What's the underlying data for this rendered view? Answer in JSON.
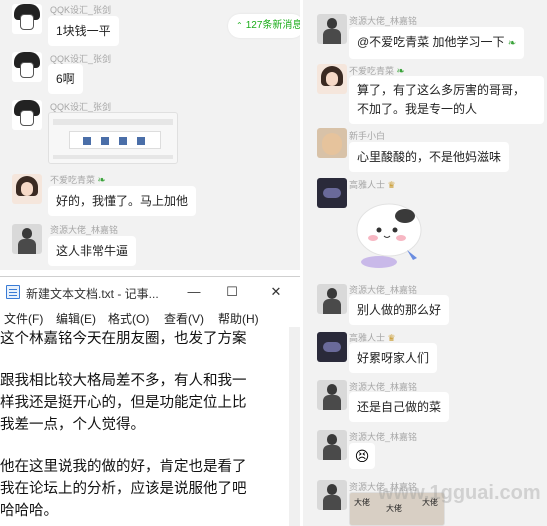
{
  "left_chat": {
    "new_messages_pill": "127条新消息",
    "messages": [
      {
        "sender": "QQK设汇_张剑",
        "text": "1块钱一平"
      },
      {
        "sender": "QQK设汇_张剑",
        "text": "6啊"
      },
      {
        "sender": "QQK设汇_张剑",
        "text": ""
      },
      {
        "sender": "不爱吃青菜",
        "text": "好的，我懂了。马上加他"
      },
      {
        "sender": "资源大佬_林嘉铭",
        "text": "这人非常牛逼"
      }
    ]
  },
  "notepad": {
    "title": "新建文本文档.txt - 记事...",
    "menus": [
      "文件(F)",
      "编辑(E)",
      "格式(O)",
      "查看(V)",
      "帮助(H)"
    ],
    "lines": [
      "这个林嘉铭今天在朋友圈，也发了方案",
      "",
      "跟我相比较大格局差不多，有人和我一",
      "样我还是挺开心的，但是功能定位上比",
      "我差一点，个人觉得。",
      "",
      "他在这里说我的做的好，肯定也是看了",
      "我在论坛上的分析，应该是说服他了吧",
      "哈哈哈。"
    ]
  },
  "right_chat": {
    "messages": [
      {
        "sender": "资源大佬_林嘉铭",
        "text": "@不爱吃青菜 加他学习一下"
      },
      {
        "sender": "不爱吃青菜",
        "text": "算了，有了这么多厉害的哥哥，不加了。我是专一的人"
      },
      {
        "sender": "新手小白",
        "text": "心里酸酸的，不是他妈滋味"
      },
      {
        "sender": "高雅人士",
        "text": ""
      },
      {
        "sender": "资源大佬_林嘉铭",
        "text": "别人做的那么好"
      },
      {
        "sender": "高雅人士",
        "text": "好累呀家人们"
      },
      {
        "sender": "资源大佬_林嘉铭",
        "text": "还是自己做的菜"
      },
      {
        "sender": "资源大佬_林嘉铭",
        "text": ""
      },
      {
        "sender": "资源大佬_林嘉铭",
        "text": ""
      }
    ],
    "sticker_labels": [
      "大佬",
      "大佬",
      "大佬"
    ]
  },
  "watermark": "www.1gguai.com",
  "colors": {
    "panel_bg": "#f2f2f2",
    "bubble_bg": "#ffffff",
    "accent_green": "#1aad19"
  }
}
